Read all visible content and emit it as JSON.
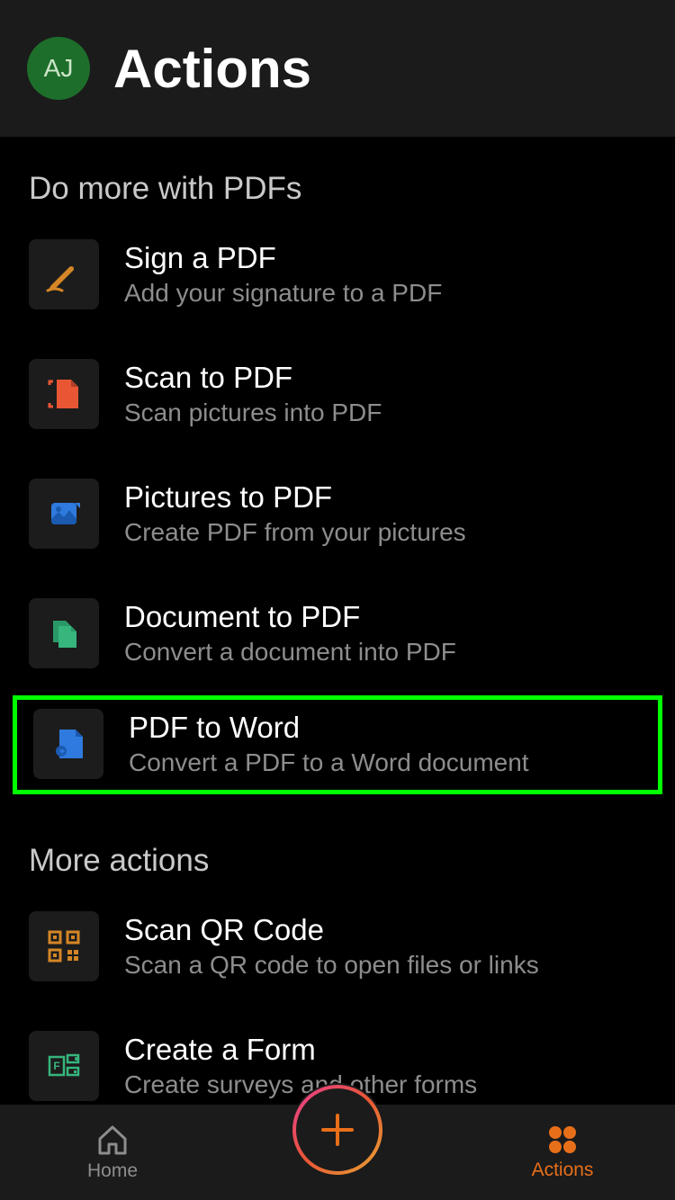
{
  "header": {
    "avatar_initials": "AJ",
    "title": "Actions"
  },
  "sections": {
    "pdf": {
      "label": "Do more with PDFs",
      "items": [
        {
          "title": "Sign a PDF",
          "desc": "Add your signature to a PDF"
        },
        {
          "title": "Scan to PDF",
          "desc": "Scan pictures into PDF"
        },
        {
          "title": "Pictures to PDF",
          "desc": "Create PDF from your pictures"
        },
        {
          "title": "Document to PDF",
          "desc": "Convert a document into PDF"
        },
        {
          "title": "PDF to Word",
          "desc": "Convert a PDF to a Word document"
        }
      ]
    },
    "more": {
      "label": "More actions",
      "items": [
        {
          "title": "Scan QR Code",
          "desc": "Scan a QR code to open files or links"
        },
        {
          "title": "Create a Form",
          "desc": "Create surveys and other forms"
        }
      ]
    }
  },
  "tabs": {
    "home": "Home",
    "actions": "Actions"
  }
}
